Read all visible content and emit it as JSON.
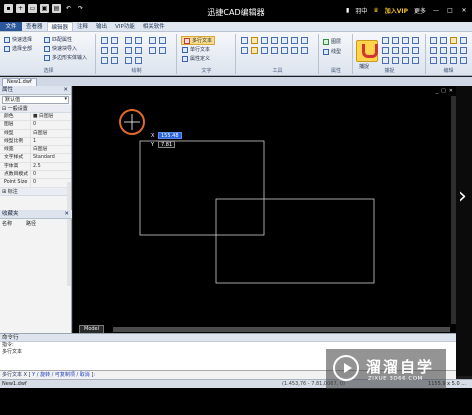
{
  "titlebar": {
    "title": "迅捷CAD编辑器",
    "user": "羽中",
    "vip": "加入VIP",
    "more": "更多",
    "min": "—",
    "max": "□",
    "close": "✕"
  },
  "tabs": [
    "文件",
    "查看器",
    "编辑器",
    "注释",
    "输出",
    "VIP功能",
    "相关软件"
  ],
  "ribbon": {
    "select_group": {
      "label": "选择",
      "items": [
        "快速选择",
        "选择全部",
        "匹配属性",
        "快速块导入",
        "多边形实体输入"
      ]
    },
    "draw_group": {
      "label": "绘制"
    },
    "text_group": {
      "label": "文字",
      "items": [
        "多行文本",
        "单行文本",
        "属性定义"
      ]
    },
    "tools_group": {
      "label": "工具"
    },
    "props_group": {
      "label": "属性",
      "items": [
        "图层",
        "线型"
      ]
    },
    "snap_group": {
      "label": "捕捉",
      "button": "捕捉"
    },
    "edit_group": {
      "label": "编辑"
    }
  },
  "doc_tab": "New1.dwf",
  "properties": {
    "title": "属性",
    "close": "✕",
    "default": "默认值",
    "category_general": "一般设置",
    "rows": [
      {
        "key": "颜色",
        "value": "■ 白图层"
      },
      {
        "key": "图层",
        "value": "0"
      },
      {
        "key": "线型",
        "value": "白图层"
      },
      {
        "key": "线型比例",
        "value": "1"
      },
      {
        "key": "线宽",
        "value": "白图层"
      },
      {
        "key": "文字样式",
        "value": "Standard"
      },
      {
        "key": "字体高",
        "value": "2.5"
      },
      {
        "key": "点数目模式",
        "value": "0"
      },
      {
        "key": "Point Size",
        "value": "0"
      }
    ],
    "category_dim": "标注"
  },
  "favorites": {
    "title": "收藏夹",
    "close": "✕",
    "col_name": "名称",
    "col_path": "路径"
  },
  "canvas": {
    "x_label": "X",
    "x_value": "155.48",
    "y_label": "Y",
    "y_value": "7.81",
    "model_tab": "Model",
    "ctrl_min": "_",
    "ctrl_restore": "□",
    "ctrl_close": "✕"
  },
  "command": {
    "title": "命令行",
    "lines": [
      "指令:",
      "多行文本"
    ],
    "input_prefix": "多行文本 X [",
    "input_options": "Y / 旋转 / 可复制项 / 取消",
    "input_suffix": "]:"
  },
  "status": {
    "file": "New1.dwf",
    "coord": "(1.453,76 - 7.81,0067, 0)",
    "zoom": "1155.9 x 5.0 ..."
  },
  "watermark": {
    "cn": "溜溜自学",
    "url": "ZIXUE.3D66.COM"
  },
  "right_arrow": "›"
}
